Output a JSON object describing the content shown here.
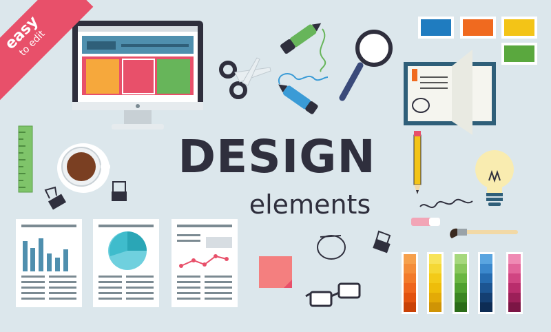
{
  "ribbon": {
    "line1": "easy",
    "line2": "to edit"
  },
  "headline": {
    "title": "DESIGN",
    "subtitle": "elements"
  },
  "colors": {
    "background": "#dce7ec",
    "ribbon": "#e8506a",
    "text": "#2f2f3d",
    "swatches": [
      "#1f7cc0",
      "#f06a1f",
      "#f3c417",
      "#5aa83e"
    ]
  },
  "icons": [
    "monitor-icon",
    "scissors-icon",
    "marker-icon",
    "magnifier-icon",
    "notebook-icon",
    "ruler-icon",
    "coffee-cup-icon",
    "binder-clip-icon",
    "pencil-icon",
    "lightbulb-icon",
    "eraser-icon",
    "paintbrush-icon",
    "sticky-note-icon",
    "glasses-icon",
    "color-strip-icon",
    "bar-chart-document-icon",
    "pie-chart-document-icon",
    "line-chart-document-icon"
  ]
}
